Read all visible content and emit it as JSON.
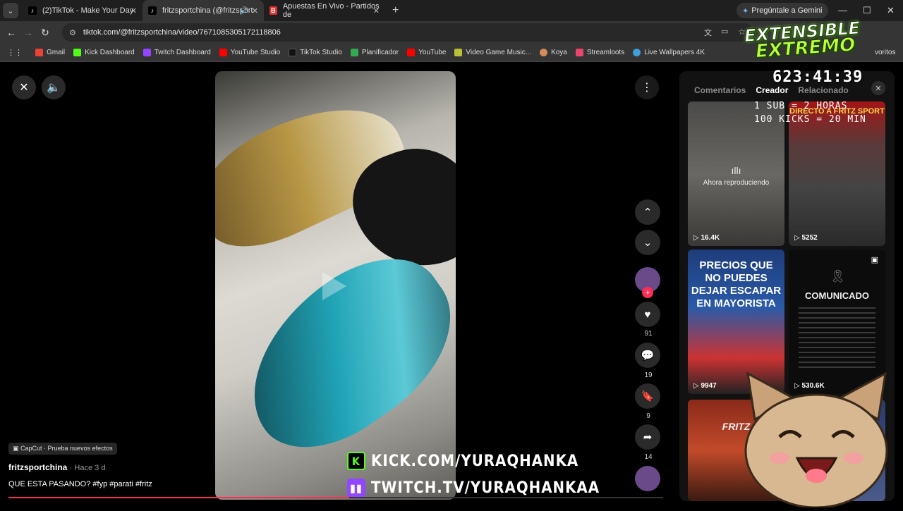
{
  "tabs": [
    {
      "label": "(2)TikTok - Make Your Day",
      "active": false
    },
    {
      "label": "fritzsportchina (@fritzsport",
      "active": true
    },
    {
      "label": "Apuestas En Vivo - Partidos de",
      "active": false
    }
  ],
  "gemini_label": "Pregúntale a Gemini",
  "url": "tiktok.com/@fritzsportchina/video/7671085305172118806",
  "bookmarks": [
    "Gmail",
    "Kick Dashboard",
    "Twitch Dashboard",
    "YouTube Studio",
    "TikTok Studio",
    "Planificador",
    "YouTube",
    "Video Game Music...",
    "Koya",
    "Streamloots",
    "Live Wallpapers 4K"
  ],
  "bookmarks_more": "voritos",
  "overlay": {
    "title_line1": "EXTENSIBLE",
    "title_line2": "EXTREMO",
    "timer": "623:41:39",
    "sub_text": "1 SUB = 2 HORAS",
    "kick_text": "100 KICKS = 20 MIN",
    "kick_url": "KICK.COM/YURAQHANKA",
    "twitch_url": "TWITCH.TV/YURAQHANKAA"
  },
  "video": {
    "likes": "91",
    "comments": "19",
    "saves": "9",
    "shares": "14",
    "badge": "CapCut · Prueba nuevos efectos",
    "author": "fritzsportchina",
    "time": "· Hace 3 d",
    "description": "QUE ESTA PASANDO? #fyp #parati #fritz",
    "progress": 0.52
  },
  "panel": {
    "tabs": [
      "Comentarios",
      "Creador",
      "Relacionado"
    ],
    "active_tab": "Creador",
    "thumbs": [
      {
        "count": "16.4K",
        "label": "Ahora reproduciendo"
      },
      {
        "count": "5252",
        "label": "DIRECTO A FRITZ SPORT"
      },
      {
        "count": "9947",
        "label": "PRECIOS QUE NO PUEDES DEJAR ESCAPAR EN MAYORISTA"
      },
      {
        "count": "530.6K",
        "label": "COMUNICADO"
      },
      {
        "count": "",
        "label": "FRITZ"
      }
    ]
  }
}
